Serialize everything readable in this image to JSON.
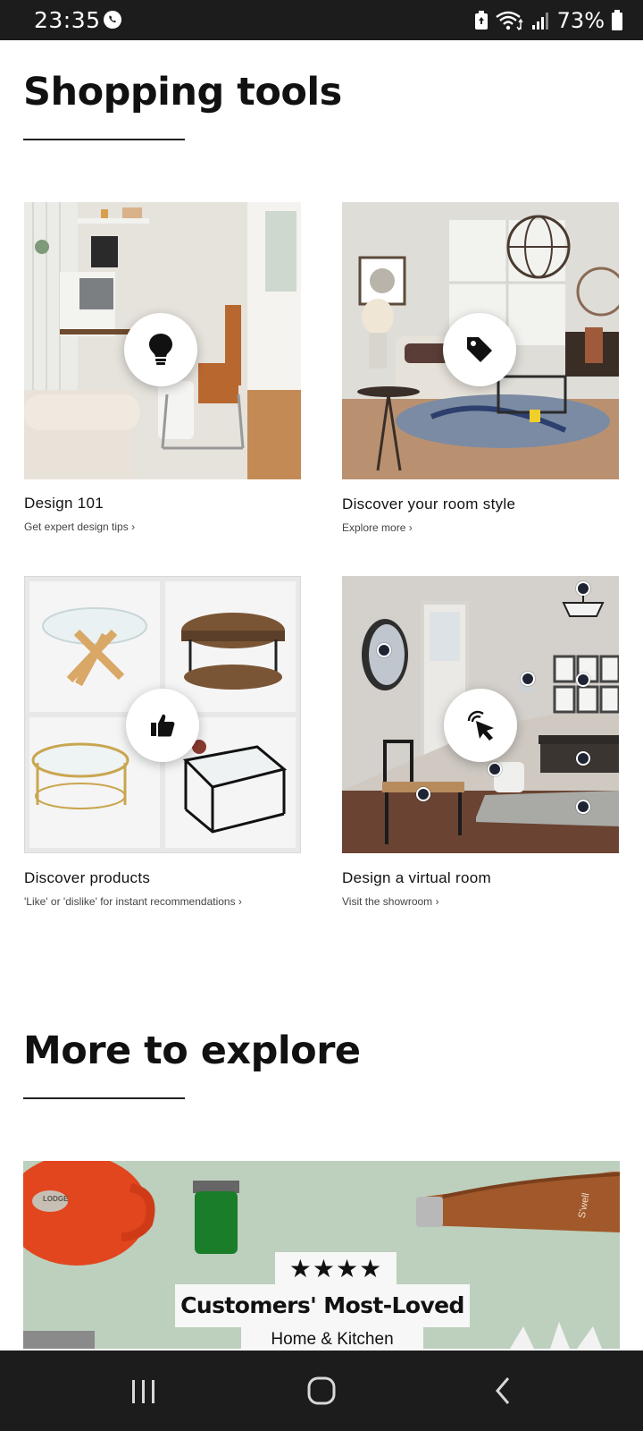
{
  "status_bar": {
    "time": "23:35",
    "battery_percent": "73%",
    "icons": [
      "whatsapp-icon",
      "battery-saver-icon",
      "wifi-icon",
      "signal-icon",
      "battery-icon"
    ]
  },
  "shopping_tools": {
    "title": "Shopping tools",
    "cards": [
      {
        "title": "Design 101",
        "subtitle": "Get expert design tips ›",
        "icon": "lightbulb-icon"
      },
      {
        "title": "Discover your room style",
        "subtitle": "Explore more ›",
        "icon": "tag-icon"
      },
      {
        "title": "Discover products",
        "subtitle": "'Like' or 'dislike' for instant recommendations ›",
        "icon": "thumbs-up-icon"
      },
      {
        "title": "Design a virtual room",
        "subtitle": "Visit the showroom ›",
        "icon": "pointer-click-icon"
      }
    ]
  },
  "more_to_explore": {
    "title": "More to explore",
    "banner": {
      "stars": "★★★★",
      "headline": "Customers' Most-Loved",
      "subline": "Home & Kitchen",
      "brand_marks": [
        "LODGE",
        "S'well"
      ]
    }
  },
  "nav_bar": {
    "icons": [
      "recent-apps-icon",
      "home-icon",
      "back-icon"
    ]
  },
  "colors": {
    "status_bar_bg": "#1c1c1c",
    "banner_bg": "#bdcfbd",
    "hotspot_dot": "#1e2433"
  }
}
